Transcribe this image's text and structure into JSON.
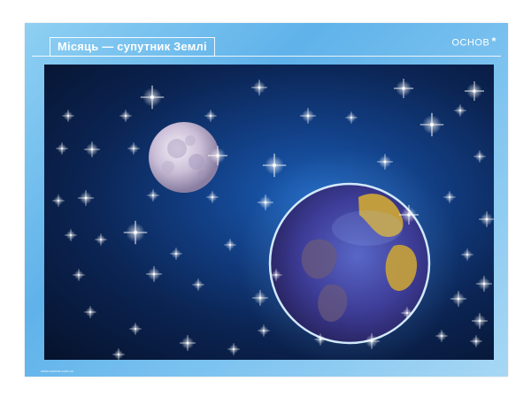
{
  "poster": {
    "title": "Місяць — супутник Землі",
    "brand": "ОСНОВ",
    "brand_mark": "★",
    "footer_url": "www.osnova.com.ua"
  },
  "illustration": {
    "moon": {
      "icon": "moon-icon",
      "color": "#d9cfe0"
    },
    "earth": {
      "icon": "earth-icon",
      "ocean": "#3b3f9a",
      "land": "#c9a239",
      "glow": "#c9e7ff"
    },
    "stars": {
      "icon": "star-icon",
      "color": "#ffffff"
    }
  }
}
